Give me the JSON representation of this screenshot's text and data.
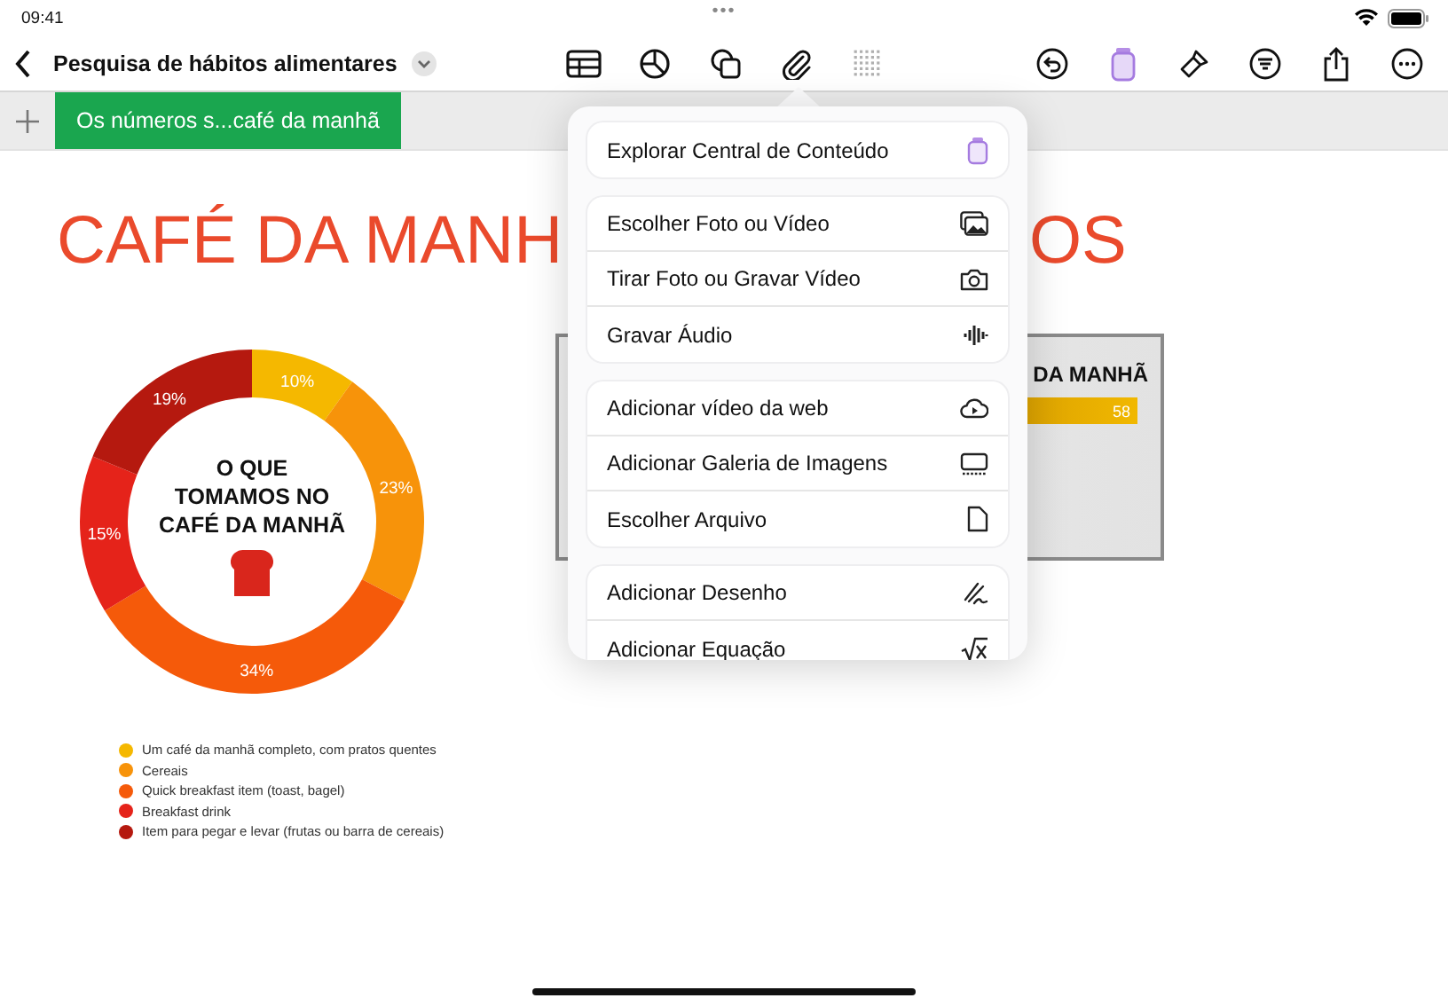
{
  "status_bar": {
    "time": "09:41",
    "dots": "•••"
  },
  "toolbar": {
    "title": "Pesquisa de hábitos alimentares",
    "tools": [
      {
        "disabled": false
      },
      {
        "disabled": false
      },
      {
        "disabled": false
      },
      {
        "disabled": false
      },
      {
        "disabled": true
      }
    ]
  },
  "sheet_tabs": [
    {
      "label": "Os números s...café da manhã",
      "selected": true
    }
  ],
  "canvas": {
    "heading_parts": [
      "CAFÉ DA MANH",
      "OS"
    ],
    "donut_chart": {
      "chart_data": {
        "type": "donut",
        "title": "O QUE\nTOMAMOS NO\nCAFÉ DA MANHÃ",
        "categories": [
          "Um café da manhã completo, com pratos quentes",
          "Cereais",
          "Quick breakfast item (toast, bagel)",
          "Breakfast drink",
          "Item para pegar e levar (frutas ou barra de cereais)"
        ],
        "values": [
          10,
          23,
          34,
          15,
          19
        ],
        "data_labels": true,
        "value_labels": [
          "10%",
          "23%",
          "34%",
          "15%",
          "19%"
        ]
      },
      "legend": [
        {
          "color": "#f5b800"
        },
        {
          "color": "#f7930a"
        },
        {
          "color": "#f55a0a"
        },
        {
          "color": "#e5231a"
        },
        {
          "color": "#b5190f"
        }
      ]
    },
    "bar_chart": {
      "title": "DA MANHÃ",
      "bar_label": "58"
    }
  },
  "insert_menu": {
    "groups": [
      {
        "items": [
          "Explorar Central de Conteúdo"
        ]
      },
      {
        "items": [
          "Escolher Foto ou Vídeo",
          "Tirar Foto ou Gravar Vídeo",
          "Gravar Áudio"
        ]
      },
      {
        "items": [
          "Adicionar vídeo da web",
          "Adicionar Galeria de Imagens",
          "Escolher Arquivo"
        ]
      },
      {
        "items": [
          "Adicionar Desenho",
          "Adicionar Equação"
        ]
      }
    ]
  }
}
